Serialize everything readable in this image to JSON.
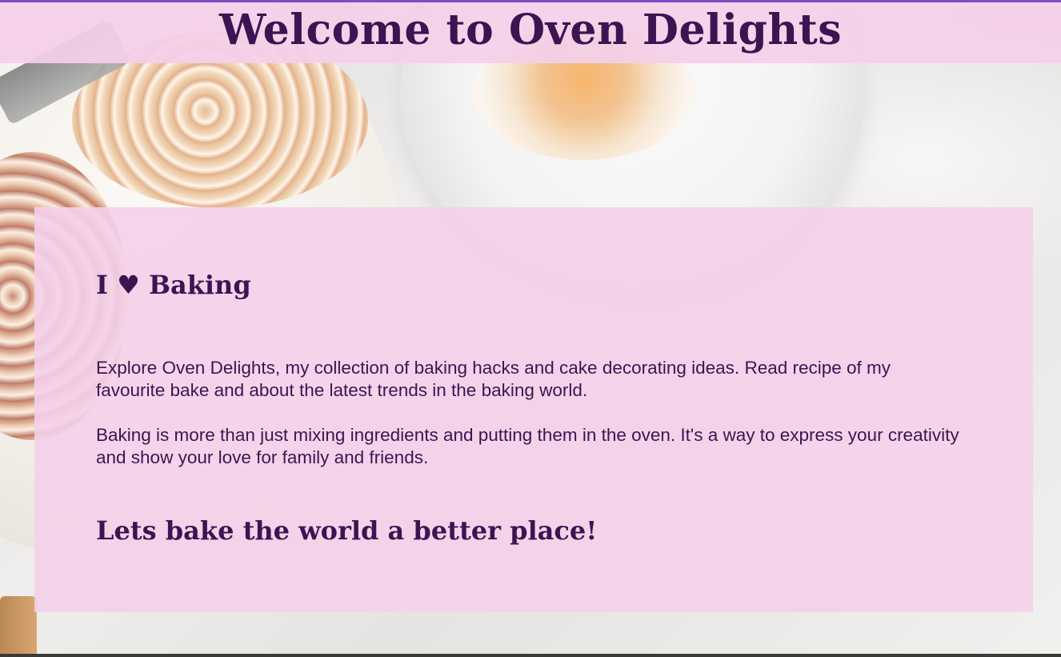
{
  "header": {
    "title": "Welcome to Oven Delights"
  },
  "main": {
    "heading": "I ♥ Baking",
    "paragraphs": [
      "Explore Oven Delights, my collection of baking hacks and cake decorating ideas. Read recipe of my favourite bake and about the latest trends in the baking world.",
      "Baking is more than just mixing ingredients and putting them in the oven. It's a way to express your creativity and show your love for family and friends."
    ],
    "tagline": "Lets bake the world a better place!"
  },
  "colors": {
    "accent_border": "#7a4fc4",
    "panel_background": "#f4d0ea",
    "text": "#3b1552"
  }
}
